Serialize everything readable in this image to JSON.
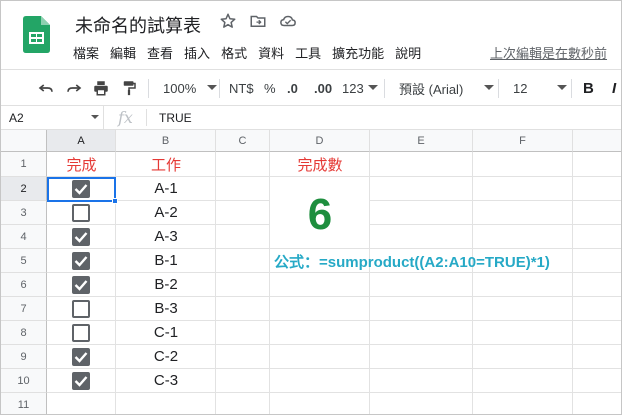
{
  "app": {
    "doc_title": "未命名的試算表",
    "menu": [
      "檔案",
      "編輯",
      "查看",
      "插入",
      "格式",
      "資料",
      "工具",
      "擴充功能",
      "說明"
    ],
    "last_edit": "上次編輯是在數秒前"
  },
  "toolbar": {
    "zoom": "100%",
    "currency": "NT$",
    "percent": "%",
    "decrease_decimal": ".0",
    "increase_decimal": ".00",
    "more_formats": "123",
    "font": "預設 (Arial)",
    "font_size": "12",
    "bold": "B",
    "italic": "I"
  },
  "formula_bar": {
    "name_box": "A2",
    "fx": "fx",
    "value": "TRUE"
  },
  "grid": {
    "columns": [
      "A",
      "B",
      "C",
      "D",
      "E",
      "F"
    ],
    "rows": [
      "1",
      "2",
      "3",
      "4",
      "5",
      "6",
      "7",
      "8",
      "9",
      "10",
      "11"
    ],
    "header_a": "完成",
    "header_b": "工作",
    "header_d": "完成數",
    "tasks": [
      {
        "done": true,
        "name": "A-1"
      },
      {
        "done": false,
        "name": "A-2"
      },
      {
        "done": true,
        "name": "A-3"
      },
      {
        "done": true,
        "name": "B-1"
      },
      {
        "done": true,
        "name": "B-2"
      },
      {
        "done": false,
        "name": "B-3"
      },
      {
        "done": false,
        "name": "C-1"
      },
      {
        "done": true,
        "name": "C-2"
      },
      {
        "done": true,
        "name": "C-3"
      }
    ],
    "count_value": "6",
    "formula_note": "公式：=sumproduct((A2:A10=TRUE)*1)"
  },
  "colors": {
    "accent": "#1a73e8",
    "header_red": "#e53935",
    "count_green": "#1e8e3e",
    "formula_cyan": "#26a9c6",
    "checkbox_gray": "#5f6368"
  }
}
